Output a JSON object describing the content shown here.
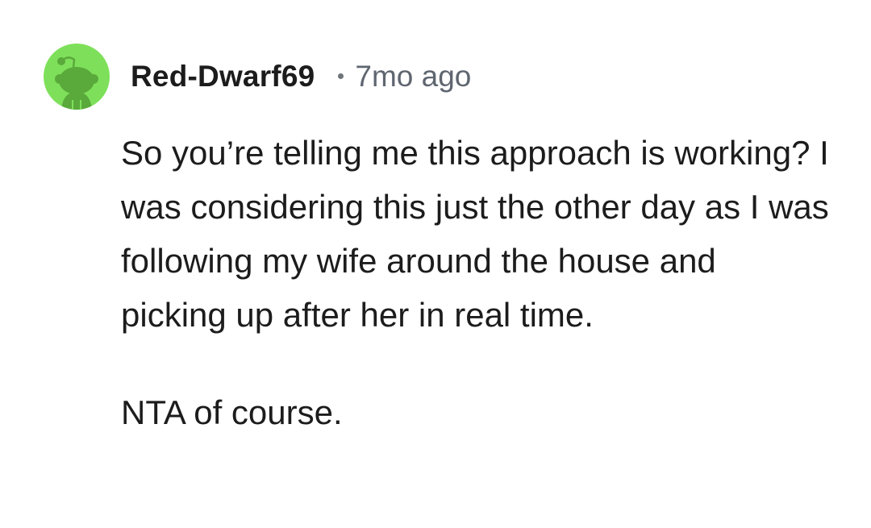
{
  "comment": {
    "author": "Red-Dwarf69",
    "separator": "•",
    "timestamp": "7mo ago",
    "avatar_icon": "reddit-snoo-avatar-icon",
    "avatar_color": "#7ee05a",
    "paragraphs": [
      "So you’re telling me this approach is working? I was considering this just the other day as I was following my wife around the house and picking up after her in real time.",
      "NTA of course."
    ]
  }
}
